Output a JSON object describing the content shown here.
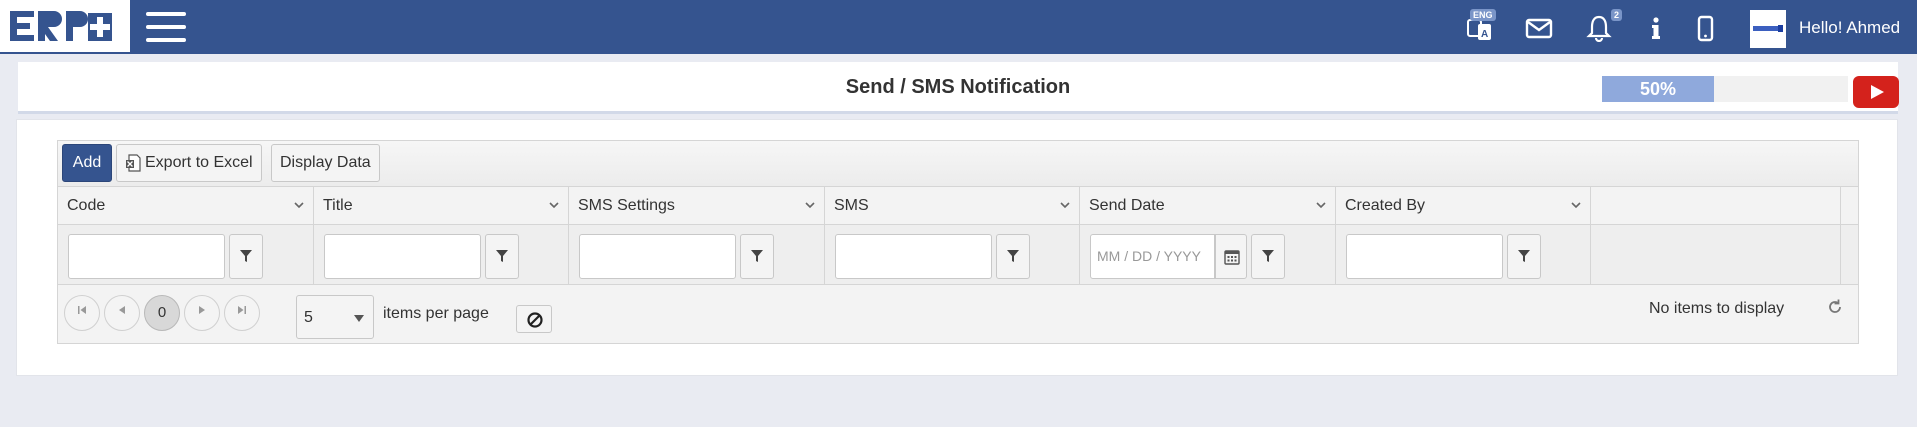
{
  "header": {
    "logo_text": "ERP+",
    "language_badge": "ENG",
    "notifications_count": "2",
    "greeting": "Hello! Ahmed"
  },
  "title_strip": {
    "title": "Send / SMS Notification",
    "progress_label": "50%",
    "progress_value": 0.5
  },
  "toolbar": {
    "add_label": "Add",
    "export_label": "Export to Excel",
    "display_label": "Display Data"
  },
  "columns": [
    {
      "label": "Code"
    },
    {
      "label": "Title"
    },
    {
      "label": "SMS Settings"
    },
    {
      "label": "SMS"
    },
    {
      "label": "Send Date"
    },
    {
      "label": "Created By"
    }
  ],
  "filters": {
    "date_placeholder": "MM / DD / YYYY"
  },
  "pager": {
    "current_page": "0",
    "page_size": "5",
    "items_per_page_label": "items per page",
    "info": "No items to display"
  },
  "colors": {
    "brand": "#35548f",
    "progress": "#8fa9dc",
    "video": "#d4221c"
  }
}
